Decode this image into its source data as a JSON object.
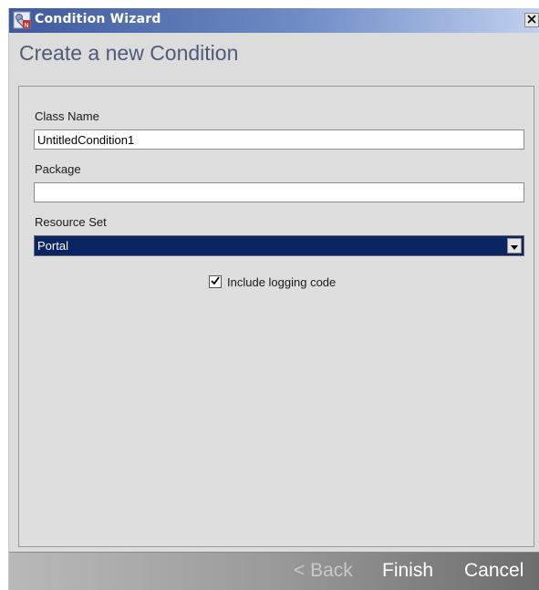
{
  "window": {
    "title": "Condition Wizard",
    "close_glyph": "X",
    "icon": "wizard-app-icon"
  },
  "header": {
    "title": "Create a new Condition"
  },
  "form": {
    "class_name": {
      "label": "Class Name",
      "value": "UntitledCondition1"
    },
    "package": {
      "label": "Package",
      "value": ""
    },
    "resource_set": {
      "label": "Resource Set",
      "selected": "Portal"
    },
    "logging": {
      "label": "Include logging code",
      "checked": true
    }
  },
  "footer": {
    "back_label": "< Back",
    "finish_label": "Finish",
    "cancel_label": "Cancel"
  },
  "colors": {
    "titlebar": "#3e5a9c",
    "selection": "#0b2563",
    "header_text": "#505a78"
  }
}
